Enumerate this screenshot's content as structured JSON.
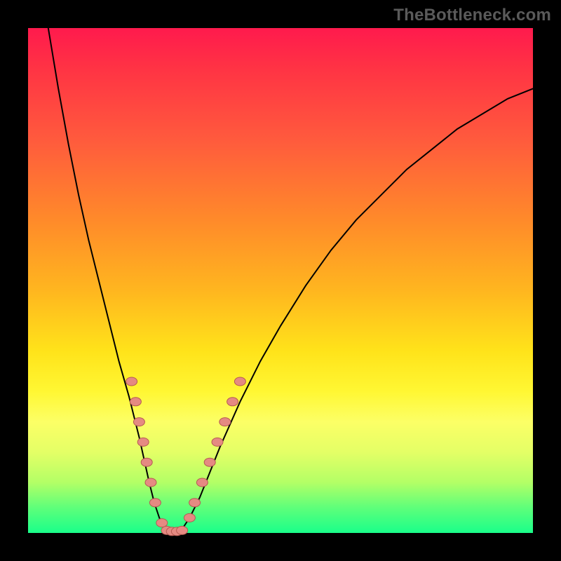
{
  "watermark": "TheBottleneck.com",
  "colors": {
    "frame_bg_top": "#ff1a4d",
    "frame_bg_bottom": "#1aff8a",
    "border": "#000000",
    "curve": "#000000",
    "dot_fill": "#e58a82",
    "dot_stroke": "#b55a52"
  },
  "chart_data": {
    "type": "line",
    "title": "",
    "xlabel": "",
    "ylabel": "",
    "xlim": [
      0,
      100
    ],
    "ylim": [
      0,
      100
    ],
    "grid": false,
    "legend": false,
    "series": [
      {
        "name": "left-branch",
        "x": [
          4,
          6,
          8,
          10,
          12,
          14,
          16,
          18,
          20,
          22,
          24,
          25,
          26,
          27,
          28
        ],
        "y": [
          100,
          88,
          77,
          67,
          58,
          50,
          42,
          34,
          27,
          19,
          10,
          6,
          3,
          1,
          0
        ]
      },
      {
        "name": "right-branch",
        "x": [
          30,
          32,
          34,
          36,
          38,
          42,
          46,
          50,
          55,
          60,
          65,
          70,
          75,
          80,
          85,
          90,
          95,
          100
        ],
        "y": [
          0,
          3,
          7,
          12,
          17,
          26,
          34,
          41,
          49,
          56,
          62,
          67,
          72,
          76,
          80,
          83,
          86,
          88
        ]
      }
    ],
    "marker_points": [
      {
        "branch": "left",
        "x": 20.5,
        "y": 30
      },
      {
        "branch": "left",
        "x": 21.3,
        "y": 26
      },
      {
        "branch": "left",
        "x": 22.0,
        "y": 22
      },
      {
        "branch": "left",
        "x": 22.8,
        "y": 18
      },
      {
        "branch": "left",
        "x": 23.5,
        "y": 14
      },
      {
        "branch": "left",
        "x": 24.3,
        "y": 10
      },
      {
        "branch": "left",
        "x": 25.2,
        "y": 6
      },
      {
        "branch": "left",
        "x": 26.5,
        "y": 2
      },
      {
        "branch": "valley",
        "x": 27.5,
        "y": 0.5
      },
      {
        "branch": "valley",
        "x": 28.5,
        "y": 0.3
      },
      {
        "branch": "valley",
        "x": 29.5,
        "y": 0.3
      },
      {
        "branch": "valley",
        "x": 30.5,
        "y": 0.5
      },
      {
        "branch": "right",
        "x": 32.0,
        "y": 3
      },
      {
        "branch": "right",
        "x": 33.0,
        "y": 6
      },
      {
        "branch": "right",
        "x": 34.5,
        "y": 10
      },
      {
        "branch": "right",
        "x": 36.0,
        "y": 14
      },
      {
        "branch": "right",
        "x": 37.5,
        "y": 18
      },
      {
        "branch": "right",
        "x": 39.0,
        "y": 22
      },
      {
        "branch": "right",
        "x": 40.5,
        "y": 26
      },
      {
        "branch": "right",
        "x": 42.0,
        "y": 30
      }
    ],
    "marker_radius_px": 8
  }
}
